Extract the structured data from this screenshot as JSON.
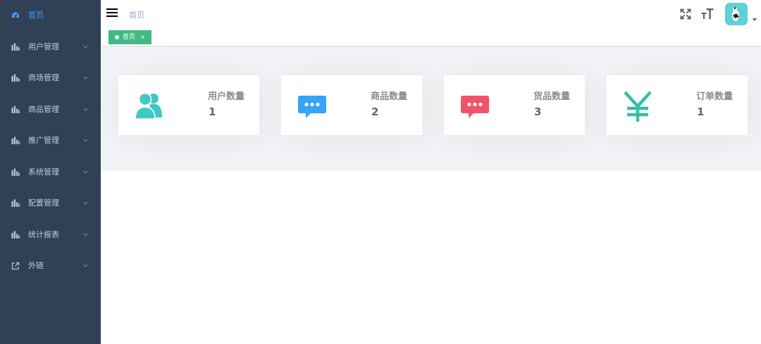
{
  "sidebar": {
    "items": [
      {
        "label": "首页",
        "icon": "dashboard-icon",
        "active": true
      },
      {
        "label": "用户管理",
        "icon": "chart-icon"
      },
      {
        "label": "商场管理",
        "icon": "chart-icon"
      },
      {
        "label": "商品管理",
        "icon": "chart-icon"
      },
      {
        "label": "推广管理",
        "icon": "chart-icon"
      },
      {
        "label": "系统管理",
        "icon": "chart-icon"
      },
      {
        "label": "配置管理",
        "icon": "chart-icon"
      },
      {
        "label": "统计报表",
        "icon": "chart-icon"
      },
      {
        "label": "外链",
        "icon": "external-link-icon"
      }
    ]
  },
  "navbar": {
    "breadcrumb": "首页",
    "icons": [
      "hamburger-icon",
      "fullscreen-icon",
      "font-size-icon",
      "avatar",
      "caret-down-icon"
    ]
  },
  "tags": {
    "active": {
      "label": "首页",
      "close": "×"
    }
  },
  "cards": [
    {
      "title": "用户数量",
      "value": "1",
      "icon": "people-icon",
      "color": "#40c9c6"
    },
    {
      "title": "商品数量",
      "value": "2",
      "icon": "message-icon",
      "color": "#36a3f7"
    },
    {
      "title": "货品数量",
      "value": "3",
      "icon": "message-icon",
      "color": "#f4516c"
    },
    {
      "title": "订单数量",
      "value": "1",
      "icon": "yuan-icon",
      "color": "#34bfa3"
    }
  ],
  "colors": {
    "sidebar_bg": "#304156",
    "sidebar_text": "#bfcbd9",
    "active_text": "#409eff",
    "tag_green": "#42b983",
    "main_bg": "#f0f2f5"
  }
}
